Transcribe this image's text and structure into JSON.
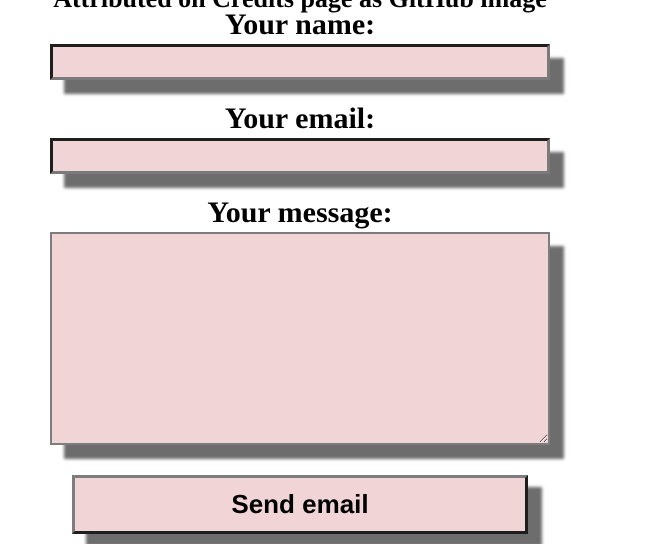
{
  "header": {
    "cutoff_text": "Attributed on Credits page as GitHub image"
  },
  "form": {
    "name_label": "Your name:",
    "name_value": "",
    "email_label": "Your email:",
    "email_value": "",
    "message_label": "Your message:",
    "message_value": "",
    "send_label": "Send email"
  },
  "colors": {
    "field_background": "#f1d5d6",
    "shadow": "#6d6d6d"
  }
}
